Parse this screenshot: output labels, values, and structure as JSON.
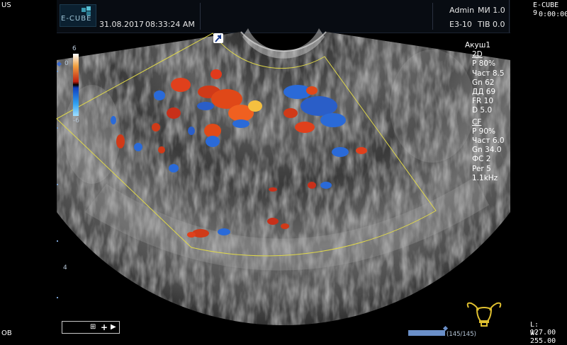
{
  "left_labels": {
    "top": "US",
    "bottom": "OB"
  },
  "header": {
    "logo": "E-CUBE",
    "date": "31.08.2017",
    "time": "08:33:24 AM",
    "user": "Admin",
    "mi": "МИ 1.0",
    "probe": "E3-10",
    "tib": "TIB 0.0"
  },
  "corner_right": {
    "system": "E-CUBE 9",
    "clock": "0:00:00"
  },
  "params": {
    "preset": "Акуш1",
    "mode_2d": "2D",
    "p2d": "P 80%",
    "freq2d": "Част 8.5",
    "gn2d": "Gn 62",
    "dd": "ДД 69",
    "fr": "FR 10",
    "d": "D 5.0",
    "mode_cf": "CF",
    "pcf": "P 90%",
    "freqcf": "Част 6.0",
    "gncf": "Gn 34.0",
    "fs": "ФС 2",
    "per": "Per 5",
    "prf": "1.1kHz"
  },
  "color_scale": {
    "top": "6",
    "zero": "0",
    "bottom": "-6"
  },
  "depth_marker": "4",
  "cine": {
    "counter": "(145/145)"
  },
  "window_level": {
    "l": "L: 127.00",
    "w": "W: 255.00"
  },
  "icons": {
    "probe_orientation": "orientation-icon",
    "uterus": "uterus-body-mark-icon"
  },
  "colors": {
    "accent": "#6a8fc8",
    "roi": "#e0d84a",
    "doppler_red": "#e0401c",
    "doppler_blue": "#2a6ad8"
  }
}
